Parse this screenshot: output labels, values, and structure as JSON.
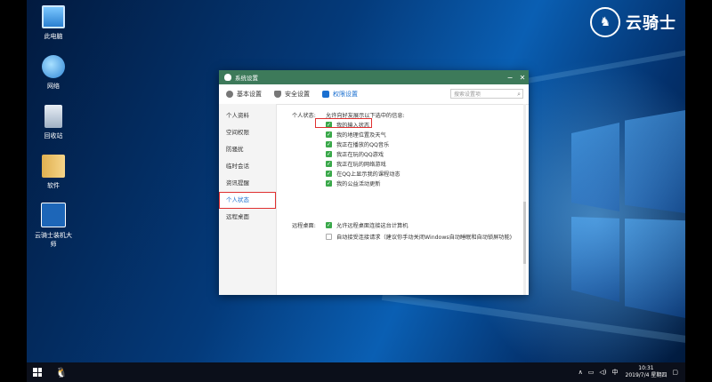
{
  "desktop": {
    "icons": [
      {
        "label": "此电脑",
        "icon": "computer-icon"
      },
      {
        "label": "网络",
        "icon": "network-icon"
      },
      {
        "label": "回收站",
        "icon": "recycle-bin-icon"
      },
      {
        "label": "软件",
        "icon": "folder-icon"
      },
      {
        "label": "云骑士装机大师",
        "icon": "yunqishi-icon"
      }
    ],
    "watermark": {
      "text": "云骑士"
    }
  },
  "window": {
    "title": "系统设置",
    "tabs": [
      {
        "label": "基本设置",
        "icon": "gear-icon"
      },
      {
        "label": "安全设置",
        "icon": "shield-icon"
      },
      {
        "label": "权限设置",
        "icon": "lock-icon",
        "active": true
      }
    ],
    "search": {
      "placeholder": "搜索设置项"
    },
    "sidebar": [
      {
        "label": "个人资料"
      },
      {
        "label": "空间权限"
      },
      {
        "label": "防骚扰"
      },
      {
        "label": "临时会话"
      },
      {
        "label": "资讯提醒"
      },
      {
        "label": "个人状态",
        "active": true
      },
      {
        "label": "远程桌面"
      }
    ],
    "personal_status": {
      "section_label": "个人状态:",
      "intro": "允许向好友展示以下选中的信息:",
      "options": [
        {
          "label": "我的输入状态",
          "checked": true,
          "highlighted": true
        },
        {
          "label": "我的地理位置及天气",
          "checked": true
        },
        {
          "label": "我正在播放的QQ音乐",
          "checked": true
        },
        {
          "label": "我正在玩的QQ游戏",
          "checked": true
        },
        {
          "label": "我正在玩的网络游戏",
          "checked": true
        },
        {
          "label": "在QQ上显示我的课程动态",
          "checked": true
        },
        {
          "label": "我的公益活动更新",
          "checked": true
        }
      ]
    },
    "remote_desktop": {
      "section_label": "远程桌面:",
      "options": [
        {
          "label": "允许远程桌面连接这台计算机",
          "checked": true
        },
        {
          "label": "自动接受连接请求（建议你手动关闭Windows自动睡眠和自动锁屏功能)",
          "checked": false
        }
      ]
    }
  },
  "taskbar": {
    "tray": {
      "ime": "中",
      "time": "10:31",
      "date": "2019/7/4 星期四"
    }
  },
  "colors": {
    "title_bar": "#3d7a5a",
    "accent": "#1a6fd0",
    "check": "#3aa84a",
    "highlight": "#e03030"
  }
}
